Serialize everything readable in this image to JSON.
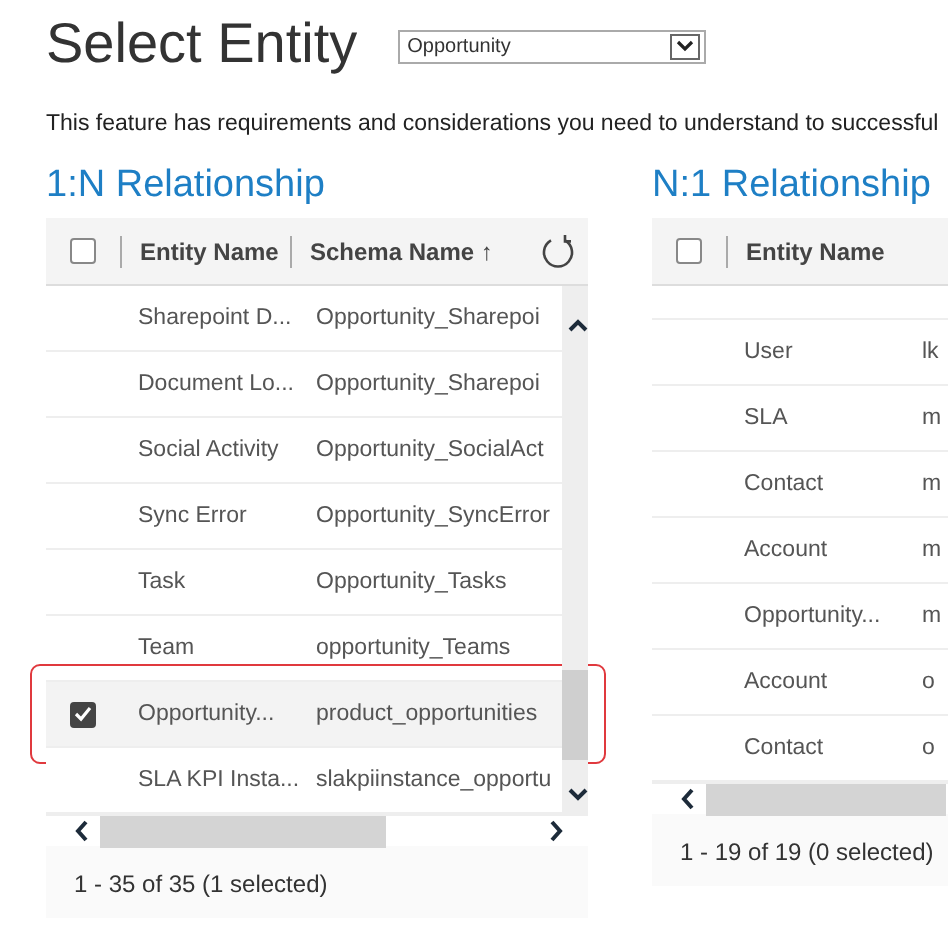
{
  "title": "Select Entity",
  "entity_select": {
    "value": "Opportunity"
  },
  "description": "This feature has requirements and considerations you need to understand to successful",
  "grids": [
    {
      "heading": "1:N Relationship",
      "columns": [
        "Entity Name",
        "Schema Name ↑"
      ],
      "refresh_button": true,
      "vertical_scrollbar": true,
      "all_checked": false,
      "rows": [
        {
          "entity_name": "Sharepoint D...",
          "schema_name": "Opportunity_Sharepoi",
          "selected": false
        },
        {
          "entity_name": "Document Lo...",
          "schema_name": "Opportunity_Sharepoi",
          "selected": false
        },
        {
          "entity_name": "Social Activity",
          "schema_name": "Opportunity_SocialAct",
          "selected": false
        },
        {
          "entity_name": "Sync Error",
          "schema_name": "Opportunity_SyncError",
          "selected": false
        },
        {
          "entity_name": "Task",
          "schema_name": "Opportunity_Tasks",
          "selected": false
        },
        {
          "entity_name": "Team",
          "schema_name": "opportunity_Teams",
          "selected": false
        },
        {
          "entity_name": "Opportunity...",
          "schema_name": "product_opportunities",
          "selected": true
        },
        {
          "entity_name": "SLA KPI Insta...",
          "schema_name": "slakpiinstance_opportu",
          "selected": false
        }
      ],
      "footer": "1 - 35 of 35 (1 selected)"
    },
    {
      "heading": "N:1 Relationship",
      "columns": [
        "Entity Name"
      ],
      "refresh_button": false,
      "vertical_scrollbar": false,
      "all_checked": false,
      "rows": [
        {
          "entity_name": "User",
          "schema_name": "lk",
          "selected": false
        },
        {
          "entity_name": "SLA",
          "schema_name": "m",
          "selected": false
        },
        {
          "entity_name": "Contact",
          "schema_name": "m",
          "selected": false
        },
        {
          "entity_name": "Account",
          "schema_name": "m",
          "selected": false
        },
        {
          "entity_name": "Opportunity...",
          "schema_name": "m",
          "selected": false
        },
        {
          "entity_name": "Account",
          "schema_name": "o",
          "selected": false
        },
        {
          "entity_name": "Contact",
          "schema_name": "o",
          "selected": false
        }
      ],
      "footer": "1 - 19 of 19 (0 selected)"
    }
  ]
}
